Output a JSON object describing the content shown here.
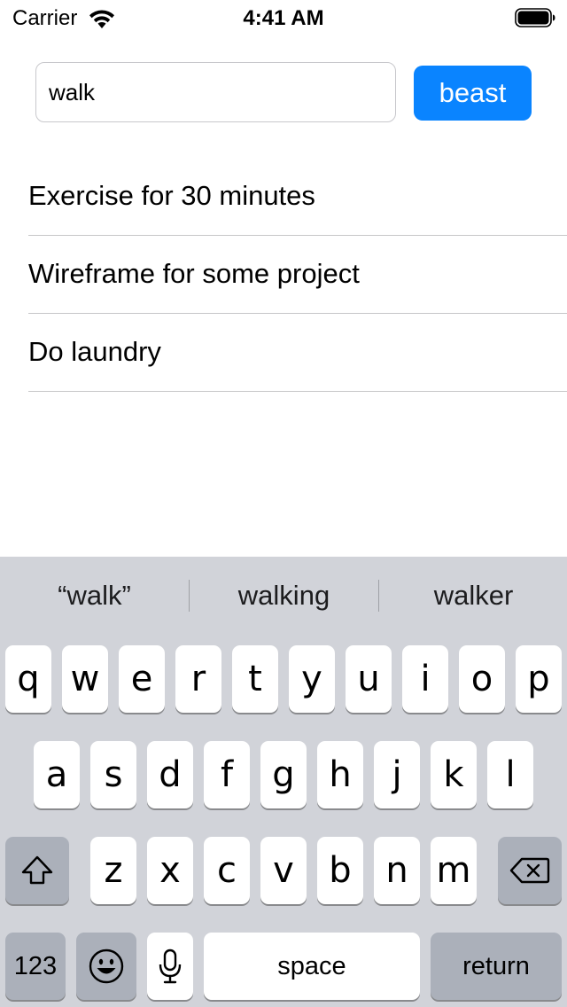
{
  "status_bar": {
    "carrier": "Carrier",
    "time": "4:41 AM"
  },
  "input": {
    "value": "walk",
    "placeholder": ""
  },
  "primary_button": {
    "label": "beast"
  },
  "list": {
    "items": [
      "Exercise for 30 minutes",
      "Wireframe for some project",
      "Do laundry"
    ]
  },
  "keyboard": {
    "suggestions": [
      "“walk”",
      "walking",
      "walker"
    ],
    "row1": [
      "q",
      "w",
      "e",
      "r",
      "t",
      "y",
      "u",
      "i",
      "o",
      "p"
    ],
    "row2": [
      "a",
      "s",
      "d",
      "f",
      "g",
      "h",
      "j",
      "k",
      "l"
    ],
    "row3": [
      "z",
      "x",
      "c",
      "v",
      "b",
      "n",
      "m"
    ],
    "numbers_label": "123",
    "space_label": "space",
    "return_label": "return",
    "icons": {
      "shift": "shift-icon",
      "delete": "delete-icon",
      "emoji": "emoji-icon",
      "mic": "microphone-icon"
    }
  },
  "colors": {
    "accent": "#0a84ff",
    "keyboard_bg": "#d1d3d9",
    "separator": "#c6c6c8"
  }
}
